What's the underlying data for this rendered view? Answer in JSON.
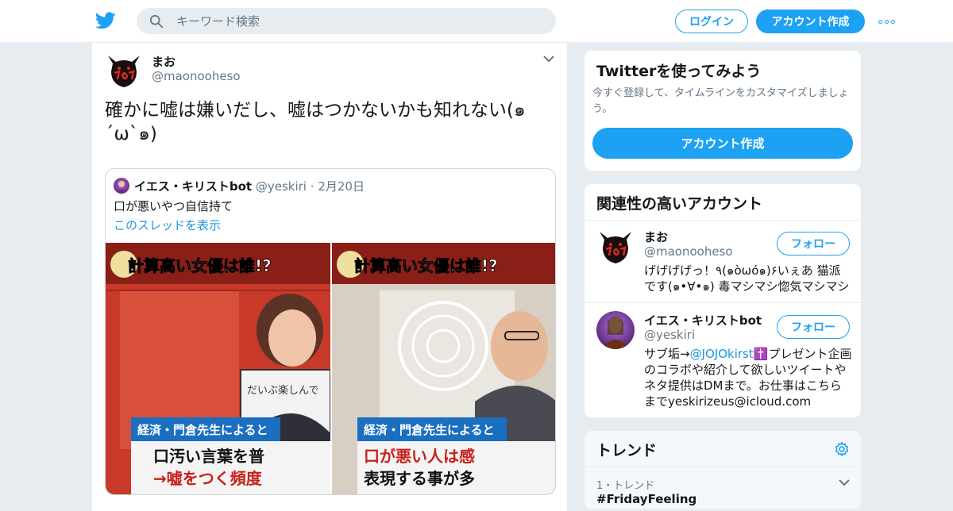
{
  "header": {
    "search_placeholder": "キーワード検索",
    "login_label": "ログイン",
    "signup_label": "アカウント作成"
  },
  "tweet": {
    "name": "まお",
    "handle": "@maonooheso",
    "text": "確かに嘘は嫌いだし、嘘はつかないかも知れない(๑´ω`๑)",
    "quote": {
      "name": "イエス・キリストbot",
      "handle": "@yeskiri",
      "separator": "·",
      "date": "2月20日",
      "text": "口が悪いやつ自信持て",
      "thread_link": "このスレッドを表示",
      "images": [
        {
          "banner": "計算高い女優は誰!?",
          "caption_top": "経済・門倉先生によると",
          "caption_line1": "口汚い言葉を普",
          "caption_line2": "→嘘をつく頻度",
          "board_text": "だいぶ楽しんで"
        },
        {
          "banner": "計算高い女優は誰!?",
          "caption_top": "経済・門倉先生によると",
          "caption_line1": "口が悪い人は感",
          "caption_line2": "表現する事が多"
        }
      ]
    }
  },
  "sidebar": {
    "signup_card": {
      "title": "Twitterを使ってみよう",
      "subtitle": "今すぐ登録して、タイムラインをカスタマイズしましょう。",
      "button": "アカウント作成"
    },
    "related": {
      "title": "関連性の高いアカウント",
      "follow_label": "フォロー",
      "accounts": [
        {
          "name": "まお",
          "handle": "@maonooheso",
          "bio": "げげげげっ！٩(๑òωó๑)۶いぇあ 猫派です(๑•∀•๑) 毒マシマシ惚気マシマシ"
        },
        {
          "name": "イエス・キリストbot",
          "handle": "@yeskiri",
          "bio_prefix": "サブ垢→",
          "bio_link": "@JOJOkirst",
          "bio_suffix": "✝️プレゼント企画のコラボや紹介して欲しいツイートやネタ提供はDMまで。お仕事はこちらまでyeskirizeus@icloud.com"
        }
      ]
    },
    "trends": {
      "title": "トレンド",
      "items": [
        {
          "label": "1・トレンド",
          "name": "#FridayFeeling"
        }
      ]
    }
  },
  "colors": {
    "accent": "#1da1f2",
    "link": "#1b95e0",
    "muted": "#657786",
    "page_bg": "#e6ecf0"
  },
  "icons": [
    "twitter-bird-icon",
    "search-icon",
    "more-icon",
    "chevron-down-icon",
    "gear-icon"
  ]
}
